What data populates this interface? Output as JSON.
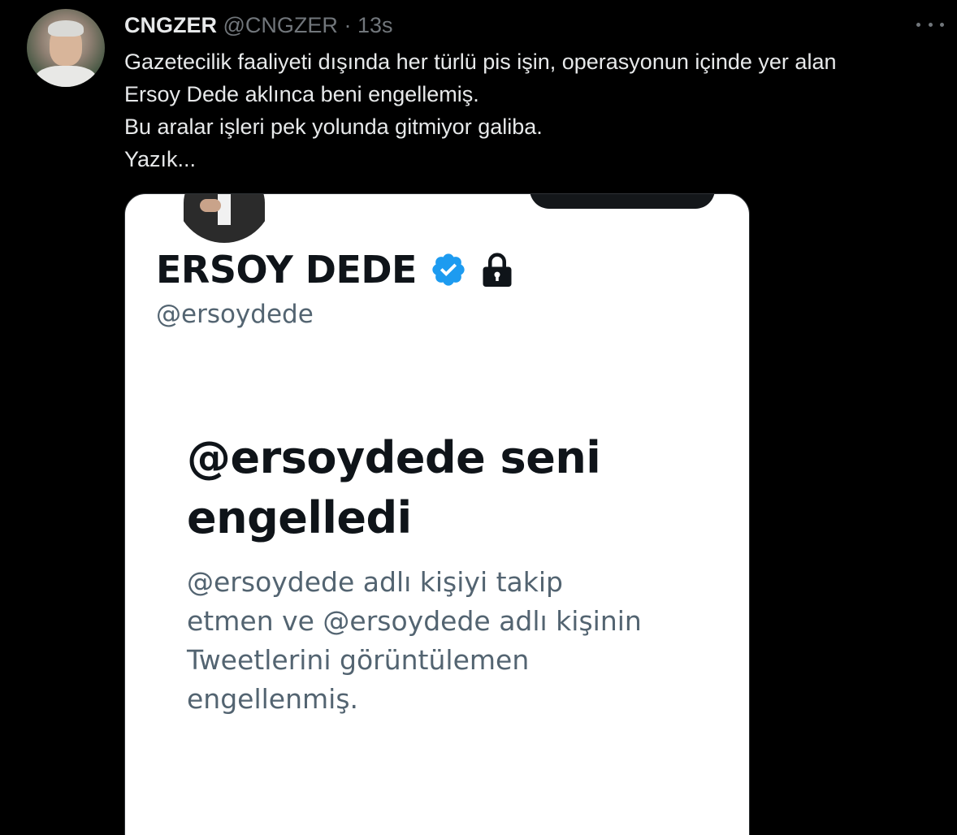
{
  "tweet": {
    "author": {
      "display_name": "CNGZER",
      "handle": "@CNGZER",
      "separator": "·",
      "time": "13s"
    },
    "text_lines": [
      "Gazetecilik faaliyeti dışında her türlü pis işin, operasyonun içinde yer alan",
      "Ersoy Dede aklınca beni engellemiş.",
      "Bu aralar işleri pek yolunda gitmiyor galiba.",
      "Yazık..."
    ],
    "more_icon": "more-horizontal-icon"
  },
  "screenshot": {
    "profile_name": "ERSOY DEDE",
    "profile_handle": "@ersoydede",
    "verified_icon": "verified-badge-icon",
    "lock_icon": "lock-icon",
    "colors": {
      "verified": "#1d9bf0",
      "title": "#0f1419",
      "secondary": "#536471"
    },
    "block_title_lines": [
      "@ersoydede seni",
      "engelledi"
    ],
    "block_desc_lines": [
      "@ersoydede adlı kişiyi takip",
      "etmen ve @ersoydede adlı kişinin",
      "Tweetlerini görüntülemen",
      "engellenmiş."
    ]
  }
}
